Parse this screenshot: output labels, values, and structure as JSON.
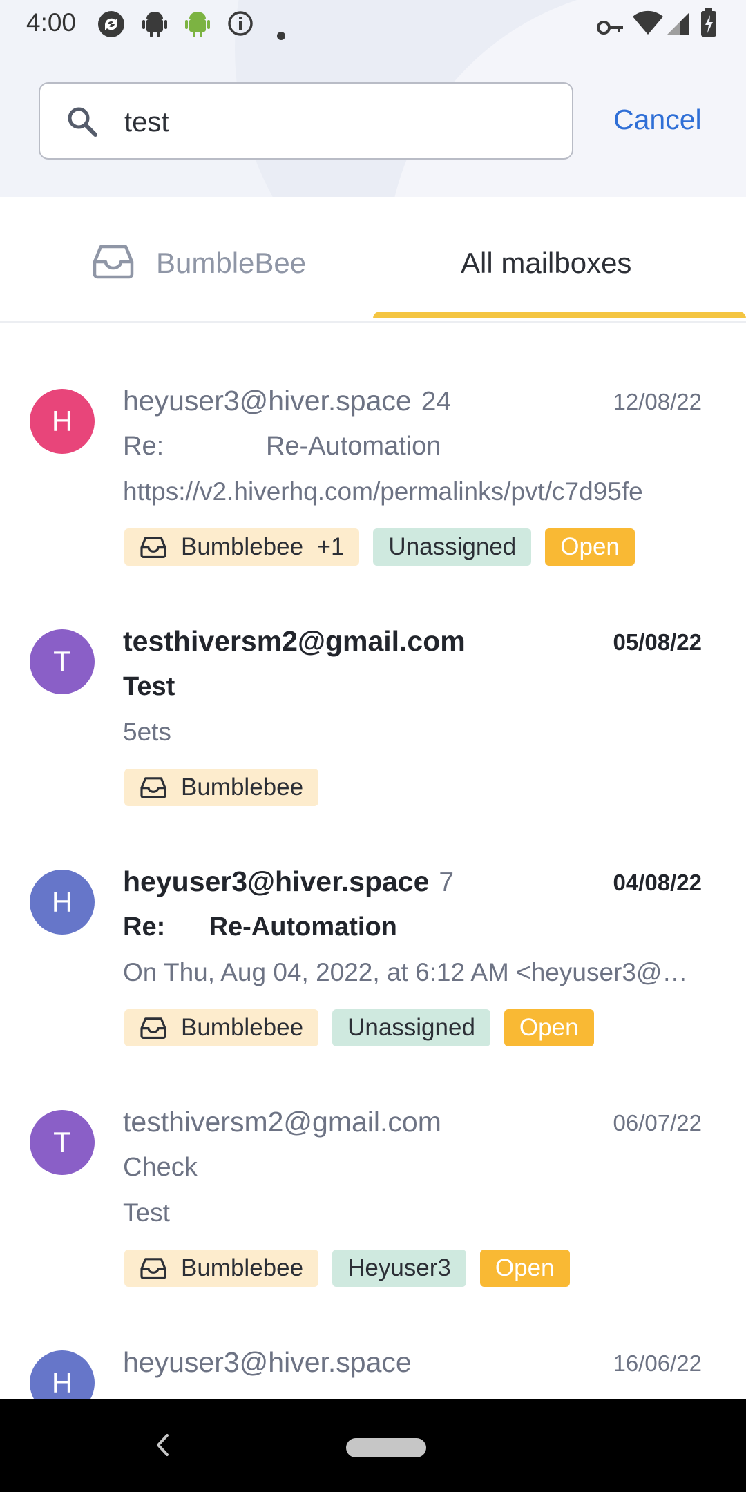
{
  "status_bar": {
    "time": "4:00",
    "icons_left": [
      "sync-icon",
      "android-icon",
      "android-green-icon",
      "info-icon",
      "dot-icon"
    ],
    "icons_right": [
      "vpn-key-icon",
      "wifi-icon",
      "signal-icon",
      "battery-charging-icon"
    ]
  },
  "search": {
    "value": "test",
    "cancel_label": "Cancel"
  },
  "tabs": [
    {
      "label": "BumbleBee",
      "icon": "inbox-icon",
      "active": false
    },
    {
      "label": "All mailboxes",
      "active": true
    }
  ],
  "colors": {
    "accent_blue": "#2f6fd6",
    "tab_indicator": "#f4c542",
    "avatar_pink": "#e8457a",
    "avatar_purple": "#8a5fc7",
    "avatar_indigo": "#6676c9",
    "tag_mailbox_bg": "#fdeccd",
    "tag_assignee_bg": "#cfe9df",
    "tag_open_bg": "#f9b934"
  },
  "conversations": [
    {
      "avatar_letter": "H",
      "sender": "heyuser3@hiver.space",
      "count": "24",
      "date": "12/08/22",
      "subject": "Re:              Re-Automation",
      "preview": "https://v2.hiverhq.com/permalinks/pvt/c7d95fe",
      "unread": false,
      "tags": {
        "mailbox": "Bumblebee  +1",
        "assignee": "Unassigned",
        "status": "Open"
      }
    },
    {
      "avatar_letter": "T",
      "sender": "testhiversm2@gmail.com",
      "count": "",
      "date": "05/08/22",
      "subject": "Test",
      "preview": "5ets",
      "unread": true,
      "tags": {
        "mailbox": "Bumblebee"
      }
    },
    {
      "avatar_letter": "H",
      "sender": "heyuser3@hiver.space",
      "count": "7",
      "date": "04/08/22",
      "subject": "Re:      Re-Automation",
      "preview": "On Thu, Aug 04, 2022, at 6:12 AM <heyuser3@…",
      "unread": true,
      "tags": {
        "mailbox": "Bumblebee",
        "assignee": "Unassigned",
        "status": "Open"
      }
    },
    {
      "avatar_letter": "T",
      "sender": "testhiversm2@gmail.com",
      "count": "",
      "date": "06/07/22",
      "subject": "Check",
      "preview": "Test",
      "unread": false,
      "tags": {
        "mailbox": "Bumblebee",
        "assignee": "Heyuser3",
        "status": "Open"
      }
    },
    {
      "avatar_letter": "H",
      "sender": "heyuser3@hiver.space",
      "count": "",
      "date": "16/06/22",
      "subject": "",
      "preview": "",
      "unread": false,
      "tags": {}
    }
  ],
  "nav_bar": {
    "icons": [
      "back-icon",
      "home-pill-icon"
    ]
  }
}
